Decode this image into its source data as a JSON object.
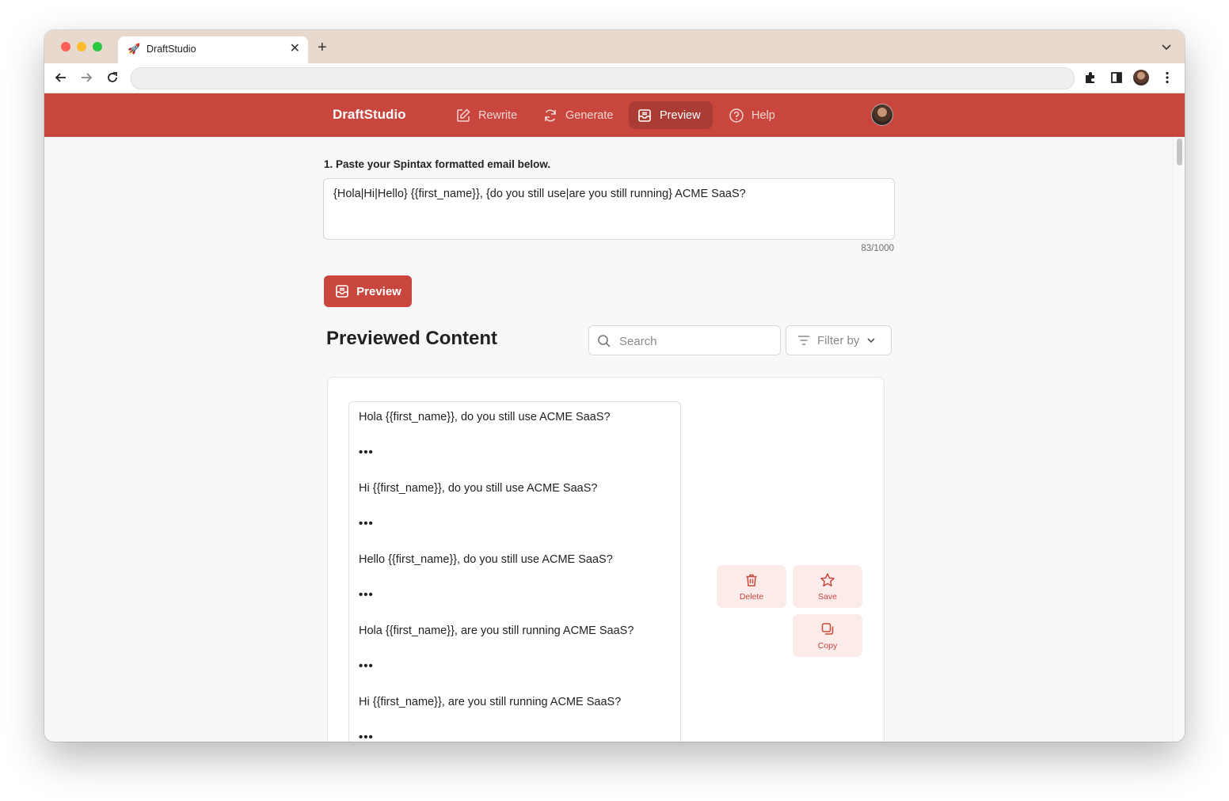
{
  "browser": {
    "tab_title": "DraftStudio",
    "tab_favicon": "🚀",
    "new_tab_label": "+",
    "close_label": "✕"
  },
  "app": {
    "brand": "DraftStudio",
    "nav": [
      {
        "label": "Rewrite",
        "icon": "edit-icon"
      },
      {
        "label": "Generate",
        "icon": "refresh-icon"
      },
      {
        "label": "Preview",
        "icon": "inbox-icon",
        "active": true
      },
      {
        "label": "Help",
        "icon": "help-circle-icon"
      }
    ],
    "accent_color": "#c8463e"
  },
  "input_section": {
    "label": "1. Paste your Spintax formatted email below.",
    "value": "{Hola|Hi|Hello} {{first_name}}, {do you still use|are you still running} ACME SaaS?",
    "counter": "83/1000"
  },
  "preview_button": {
    "label": "Preview"
  },
  "results": {
    "title": "Previewed Content",
    "search_placeholder": "Search",
    "filter_label": "Filter by",
    "separator": "•••",
    "variants": [
      "Hola {{first_name}}, do you still use ACME SaaS?",
      "Hi {{first_name}}, do you still use ACME SaaS?",
      "Hello {{first_name}}, do you still use ACME SaaS?",
      "Hola {{first_name}}, are you still running ACME SaaS?",
      "Hi {{first_name}}, are you still running ACME SaaS?"
    ],
    "actions": {
      "delete": "Delete",
      "save": "Save",
      "copy": "Copy"
    }
  }
}
